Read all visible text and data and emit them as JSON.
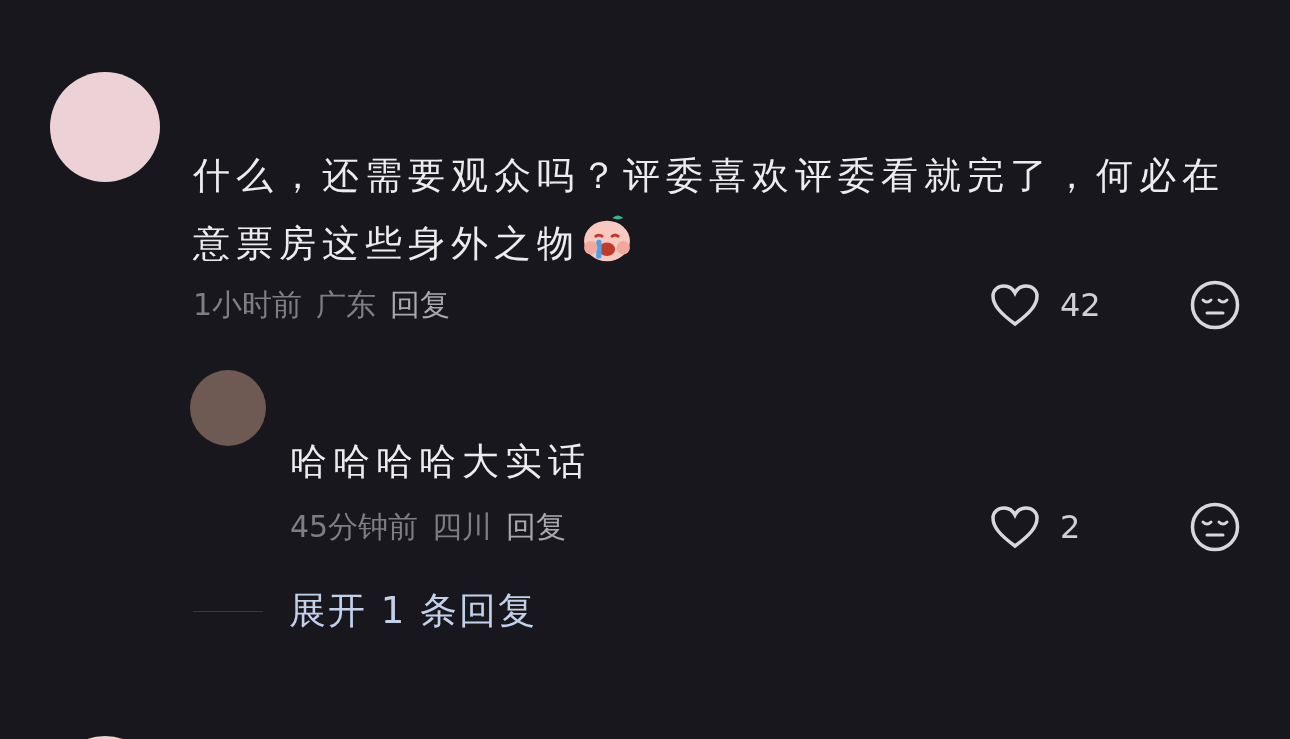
{
  "comments": [
    {
      "text": "什么，还需要观众吗？评委喜欢评委看就完了，何必在意票房这些身外之物",
      "emoji": true,
      "time": "1小时前",
      "location": "广东",
      "reply_label": "回复",
      "likes": "42",
      "liked": false,
      "replies": [
        {
          "text": "哈哈哈哈大实话",
          "time": "45分钟前",
          "location": "四川",
          "reply_label": "回复",
          "likes": "2",
          "liked": false
        }
      ]
    }
  ],
  "expand_replies": "展开 1 条回复"
}
